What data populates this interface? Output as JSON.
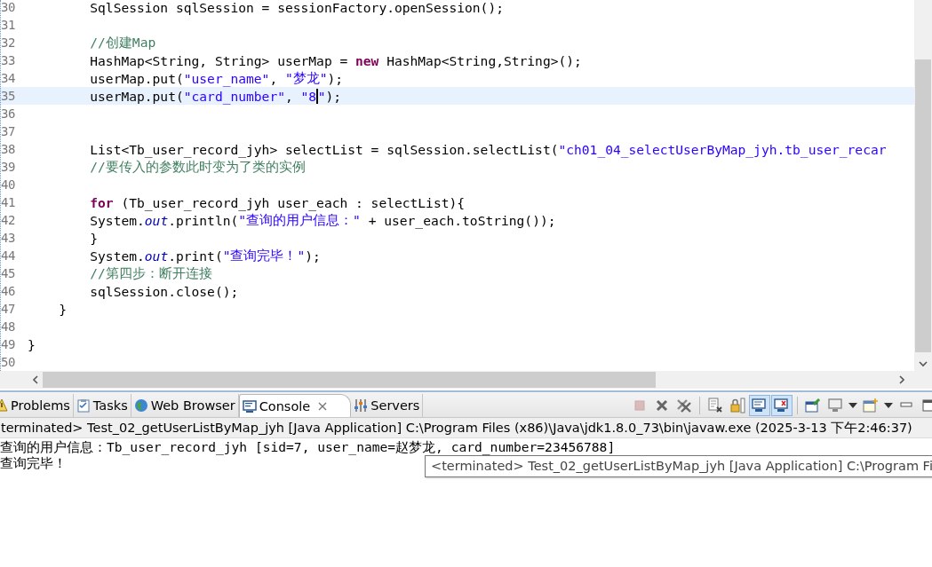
{
  "editor": {
    "lines": [
      {
        "number": "30",
        "current": false,
        "tokens": [
          {
            "kind": "plain",
            "text": "        SqlSession sqlSession = sessionFactory.openSession();"
          }
        ]
      },
      {
        "number": "31",
        "current": false
      },
      {
        "number": "32",
        "current": false,
        "tokens": [
          {
            "kind": "comment",
            "text": "        //创建Map"
          }
        ]
      },
      {
        "number": "33",
        "current": false,
        "tokens": [
          {
            "kind": "plain",
            "text": "        HashMap<String, String> userMap = "
          },
          {
            "kind": "keyword",
            "text": "new"
          },
          {
            "kind": "plain",
            "text": " HashMap<String,String>();"
          }
        ]
      },
      {
        "number": "34",
        "current": false,
        "tokens": [
          {
            "kind": "plain",
            "text": "        userMap.put("
          },
          {
            "kind": "string",
            "text": "\"user_name\""
          },
          {
            "kind": "plain",
            "text": ", "
          },
          {
            "kind": "string",
            "text": "\"梦龙\""
          },
          {
            "kind": "plain",
            "text": ");"
          }
        ]
      },
      {
        "number": "35",
        "current": true,
        "tokens": [
          {
            "kind": "plain",
            "text": "        userMap.put("
          },
          {
            "kind": "string",
            "text": "\"card_number\""
          },
          {
            "kind": "plain",
            "text": ", "
          },
          {
            "kind": "string",
            "text": "\"8"
          },
          {
            "kind": "caret"
          },
          {
            "kind": "string",
            "text": "\""
          },
          {
            "kind": "plain",
            "text": ");"
          }
        ]
      },
      {
        "number": "36",
        "current": false
      },
      {
        "number": "37",
        "current": false
      },
      {
        "number": "38",
        "current": false,
        "tokens": [
          {
            "kind": "plain",
            "text": "        List<Tb_user_record_jyh> selectList = sqlSession.selectList("
          },
          {
            "kind": "string",
            "text": "\"ch01_04_selectUserByMap_jyh.tb_user_recar"
          }
        ]
      },
      {
        "number": "39",
        "current": false,
        "tokens": [
          {
            "kind": "comment",
            "text": "        //要传入的参数此时变为了类的实例"
          }
        ]
      },
      {
        "number": "40",
        "current": false
      },
      {
        "number": "41",
        "current": false,
        "tokens": [
          {
            "kind": "keyword",
            "text": "        for"
          },
          {
            "kind": "plain",
            "text": " (Tb_user_record_jyh user_each : selectList){"
          }
        ]
      },
      {
        "number": "42",
        "current": false,
        "tokens": [
          {
            "kind": "plain",
            "text": "        System."
          },
          {
            "kind": "field",
            "text": "out"
          },
          {
            "kind": "plain",
            "text": ".println("
          },
          {
            "kind": "string",
            "text": "\"查询的用户信息：\""
          },
          {
            "kind": "plain",
            "text": " + user_each.toString());"
          }
        ]
      },
      {
        "number": "43",
        "current": false,
        "tokens": [
          {
            "kind": "plain",
            "text": "        }"
          }
        ]
      },
      {
        "number": "44",
        "current": false,
        "tokens": [
          {
            "kind": "plain",
            "text": "        System."
          },
          {
            "kind": "field",
            "text": "out"
          },
          {
            "kind": "plain",
            "text": ".print("
          },
          {
            "kind": "string",
            "text": "\"查询完毕！\""
          },
          {
            "kind": "plain",
            "text": ");"
          }
        ]
      },
      {
        "number": "45",
        "current": false,
        "tokens": [
          {
            "kind": "comment",
            "text": "        //第四步：断开连接"
          }
        ]
      },
      {
        "number": "46",
        "current": false,
        "tokens": [
          {
            "kind": "plain",
            "text": "        sqlSession.close();"
          }
        ]
      },
      {
        "number": "47",
        "current": false,
        "tokens": [
          {
            "kind": "plain",
            "text": "    }"
          }
        ]
      },
      {
        "number": "48",
        "current": false
      },
      {
        "number": "49",
        "current": false,
        "tokens": [
          {
            "kind": "plain",
            "text": "}"
          }
        ]
      },
      {
        "number": "50",
        "current": false
      }
    ]
  },
  "tabs": [
    {
      "label": "Problems",
      "kind": "problems",
      "selected": false,
      "closable": false
    },
    {
      "label": "Tasks",
      "kind": "tasks",
      "selected": false,
      "closable": false
    },
    {
      "label": "Web Browser",
      "kind": "browser",
      "selected": false,
      "closable": false
    },
    {
      "label": "Console",
      "kind": "console",
      "selected": true,
      "closable": true
    },
    {
      "label": "Servers",
      "kind": "servers",
      "selected": false,
      "closable": false
    }
  ],
  "toolbar": [
    {
      "kind": "stop",
      "pressed": false,
      "disabled": true
    },
    {
      "kind": "remove",
      "pressed": false,
      "disabled": false
    },
    {
      "kind": "remove-all",
      "pressed": false,
      "disabled": false
    },
    {
      "kind": "separator"
    },
    {
      "kind": "clear",
      "pressed": false,
      "disabled": false
    },
    {
      "kind": "scroll-lock",
      "pressed": false,
      "disabled": false
    },
    {
      "kind": "stdout",
      "pressed": true,
      "disabled": false
    },
    {
      "kind": "stderr",
      "pressed": true,
      "disabled": false
    },
    {
      "kind": "separator"
    },
    {
      "kind": "pin",
      "pressed": false,
      "disabled": false
    },
    {
      "kind": "display",
      "pressed": false,
      "disabled": false
    },
    {
      "kind": "dropdown",
      "pressed": false,
      "disabled": false
    },
    {
      "kind": "new-console",
      "pressed": false,
      "disabled": false
    },
    {
      "kind": "dropdown",
      "pressed": false,
      "disabled": false
    },
    {
      "kind": "minimize",
      "pressed": false,
      "disabled": false
    },
    {
      "kind": "maximize",
      "pressed": false,
      "disabled": false
    }
  ],
  "console": {
    "header": "terminated> Test_02_getUserListByMap_jyh [Java Application] C:\\Program Files (x86)\\Java\\jdk1.8.0_73\\bin\\javaw.exe (2025-3-13 下午2:46:37)",
    "lines": [
      "查询的用户信息：Tb_user_record_jyh [sid=7, user_name=赵梦龙, card_number=23456788]",
      "查询完毕！"
    ],
    "tooltip": "<terminated> Test_02_getUserListByMap_jyh [Java Application] C:\\Program Fi"
  }
}
